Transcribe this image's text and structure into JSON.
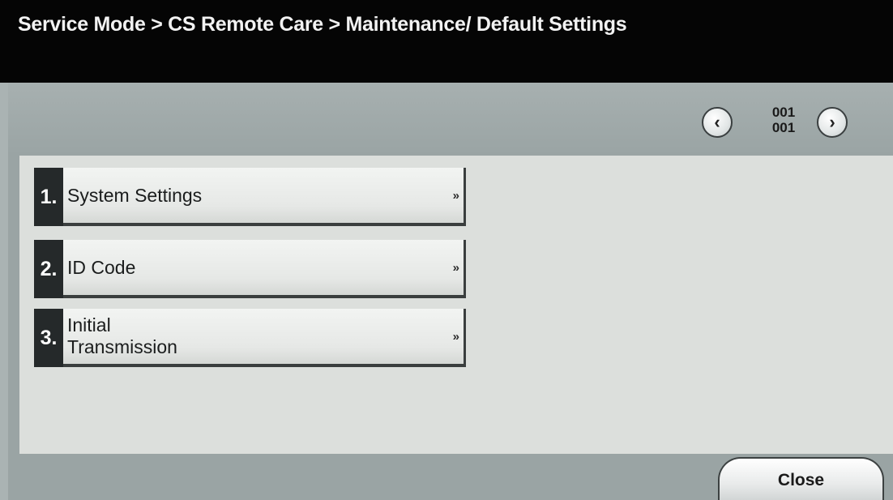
{
  "header": {
    "breadcrumb": "Service Mode > CS Remote Care > Maintenance/ Default Settings"
  },
  "pager": {
    "prev_icon": "chevron-left-icon",
    "next_icon": "chevron-right-icon",
    "prev_glyph": "‹",
    "next_glyph": "›",
    "current_page": "001",
    "total_pages": "001"
  },
  "menu": {
    "items": [
      {
        "number": "1.",
        "label": "System Settings",
        "arrow": "»"
      },
      {
        "number": "2.",
        "label": "ID Code",
        "arrow": "»"
      },
      {
        "number": "3.",
        "label": "Initial Transmission",
        "arrow": "»"
      }
    ]
  },
  "footer": {
    "close_label": "Close"
  },
  "colors": {
    "title_background": "#050505",
    "screen_background": "#9aa4a4",
    "panel_background": "#dcdfdc",
    "number_block": "#25292a"
  }
}
